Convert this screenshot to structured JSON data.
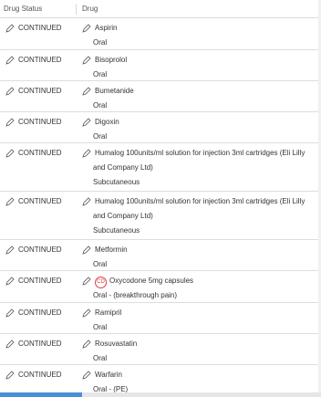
{
  "header": {
    "status": "Drug Status",
    "drug": "Drug"
  },
  "rows": [
    {
      "status": "CONTINUED",
      "name": "Aspirin",
      "route": "Oral",
      "cd": false
    },
    {
      "status": "CONTINUED",
      "name": "Bisoprolol",
      "route": "Oral",
      "cd": false
    },
    {
      "status": "CONTINUED",
      "name": "Bumetanide",
      "route": "Oral",
      "cd": false
    },
    {
      "status": "CONTINUED",
      "name": "Digoxin",
      "route": "Oral",
      "cd": false
    },
    {
      "status": "CONTINUED",
      "name": "Humalog 100units/ml solution for injection 3ml cartridges (Eli Lilly",
      "name2": "and Company Ltd)",
      "route": "Subcutaneous",
      "cd": false
    },
    {
      "status": "CONTINUED",
      "name": "Humalog 100units/ml solution for injection 3ml cartridges (Eli Lilly",
      "name2": "and Company Ltd)",
      "route": "Subcutaneous",
      "cd": false
    },
    {
      "status": "CONTINUED",
      "name": "Metformin",
      "route": "Oral",
      "cd": false
    },
    {
      "status": "CONTINUED",
      "name": "Oxycodone 5mg capsules",
      "route": "Oral - (breakthrough pain)",
      "cd": true,
      "cd_label": "CD"
    },
    {
      "status": "CONTINUED",
      "name": "Ramipril",
      "route": "Oral",
      "cd": false
    },
    {
      "status": "CONTINUED",
      "name": "Rosuvastatin",
      "route": "Oral",
      "cd": false
    },
    {
      "status": "CONTINUED",
      "name": "Warfarin",
      "route": "Oral - (PE)",
      "cd": false
    }
  ],
  "icons": {
    "edit": "pencil-icon",
    "controlled_drug": "cd-badge"
  },
  "colors": {
    "cd": "#e04040",
    "scroll_thumb": "#4a90d9"
  }
}
